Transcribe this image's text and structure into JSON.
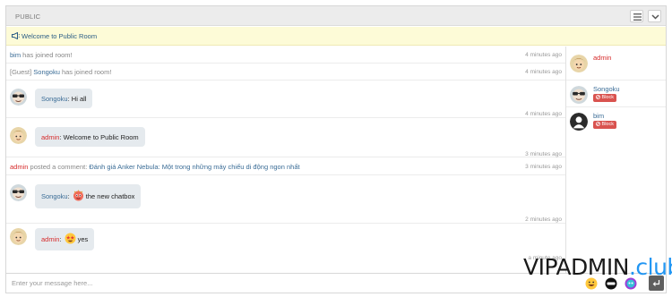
{
  "header": {
    "title": "PUBLIC",
    "menu_icon": "hamburger-menu-icon",
    "collapse_icon": "chevron-down-icon"
  },
  "welcome": {
    "icon": "megaphone-icon",
    "text": "Welcome to Public Room"
  },
  "messages": [
    {
      "kind": "system",
      "user": "bim",
      "text": " has joined room!",
      "time": "4 minutes ago"
    },
    {
      "kind": "system",
      "prefix": "[Guest] ",
      "user": "Songoku",
      "text": " has joined room!",
      "time": "4 minutes ago"
    },
    {
      "kind": "chat",
      "user": "Songoku",
      "sep": ": ",
      "text": "Hi all",
      "time": "4 minutes ago"
    },
    {
      "kind": "chat",
      "user": "admin",
      "sep": ": ",
      "text": "Welcome to Public Room",
      "time": "3 minutes ago"
    },
    {
      "kind": "comment",
      "user": "admin",
      "text": " posted a comment: ",
      "link": "Đánh giá Anker Nebula: Một trong những máy chiếu di động ngon nhất",
      "time": "3 minutes ago"
    },
    {
      "kind": "chat",
      "user": "Songoku",
      "sep": ": ",
      "text": "the new chatbox",
      "time": "2 minutes ago"
    },
    {
      "kind": "chat",
      "user": "admin",
      "sep": ": ",
      "text": "yes",
      "time": "a minute ago"
    }
  ],
  "users": [
    {
      "name": "admin"
    },
    {
      "name": "Songoku",
      "block_label": "Block"
    },
    {
      "name": "bim",
      "block_label": "Block"
    }
  ],
  "composer": {
    "placeholder": "Enter your message here...",
    "send_icon": "enter-arrow-icon"
  },
  "watermark": {
    "part1": "VIPADMIN",
    "part2": ".club"
  },
  "colors": {
    "accent": "#3a6c96",
    "admin": "#d62b2b",
    "block": "#d9534f",
    "welcome_bg": "#fdfbd7",
    "bubble_bg": "#e5eaee"
  }
}
